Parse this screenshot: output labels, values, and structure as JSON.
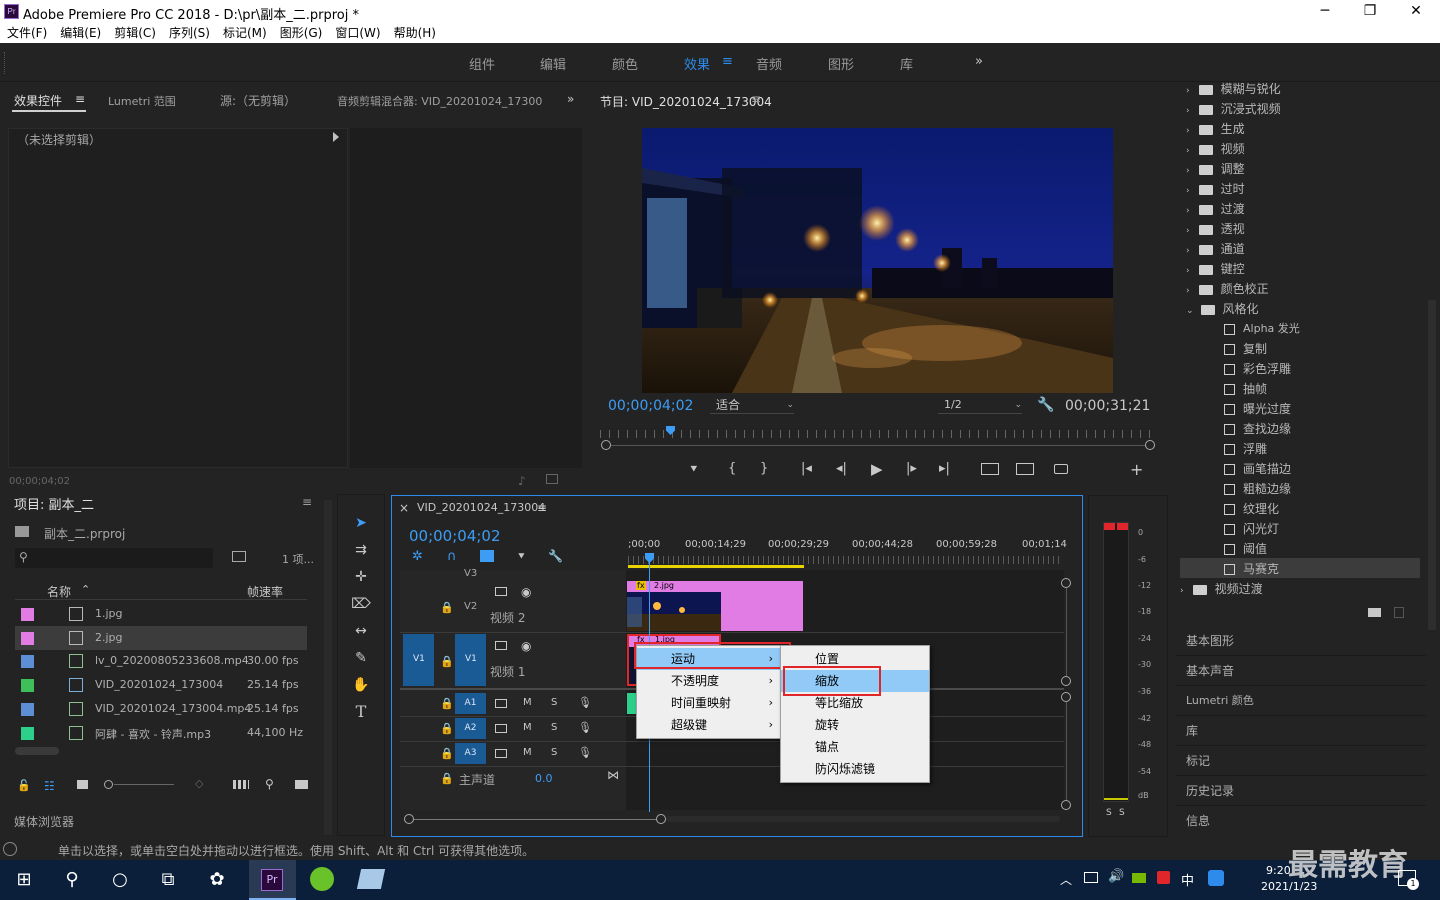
{
  "window": {
    "app_logo": "Pr",
    "title": "Adobe Premiere Pro CC 2018 - D:\\pr\\副本_二.prproj *",
    "minimize": "─",
    "maximize": "❐",
    "close": "✕"
  },
  "menu": [
    "文件(F)",
    "编辑(E)",
    "剪辑(C)",
    "序列(S)",
    "标记(M)",
    "图形(G)",
    "窗口(W)",
    "帮助(H)"
  ],
  "workspaces": {
    "items": [
      "组件",
      "编辑",
      "颜色",
      "效果",
      "音频",
      "图形",
      "库"
    ],
    "active": "效果",
    "more": "»",
    "menu_icon": "≡"
  },
  "effect_controls": {
    "tabs": [
      "效果控件",
      "Lumetri 范围",
      "源:（无剪辑）",
      "音频剪辑混合器: VID_20201024_17300"
    ],
    "active_tab": "效果控件",
    "tab_menu": "≡",
    "more": "»",
    "no_clip": "（未选择剪辑）",
    "timecode": "00;00;04;02"
  },
  "program": {
    "title": "节目: VID_20201024_173004",
    "menu": "≡",
    "timecode_current": "00;00;04;02",
    "zoom": "适合",
    "resolution": "1/2",
    "timecode_duration": "00;00;31;21",
    "add": "+"
  },
  "project": {
    "title": "项目: 副本_二",
    "menu": "≡",
    "file": "副本_二.prproj",
    "count": "1 项...",
    "columns": [
      "名称",
      "帧速率"
    ],
    "rows": [
      {
        "name": "1.jpg",
        "fps": "",
        "color": "#e27ce5"
      },
      {
        "name": "2.jpg",
        "fps": "",
        "color": "#e27ce5"
      },
      {
        "name": "lv_0_20200805233608.mp4",
        "fps": "30.00 fps",
        "color": "#5d8fd4"
      },
      {
        "name": "VID_20201024_173004",
        "fps": "25.14 fps",
        "color": "#3fbf5a"
      },
      {
        "name": "VID_20201024_173004.mp4",
        "fps": "25.14 fps",
        "color": "#5d8fd4"
      },
      {
        "name": "阿肆 - 喜欢 - 铃声.mp3",
        "fps": "44,100 Hz",
        "color": "#2ecf8a"
      }
    ],
    "media_browser": "媒体浏览器"
  },
  "timeline": {
    "tab": "VID_20201024_173004",
    "close": "×",
    "menu": "≡",
    "timecode": "00;00;04;02",
    "ruler": [
      ";00;00",
      "00;00;14;29",
      "00;00;29;29",
      "00;00;44;28",
      "00;00;59;28",
      "00;01;14"
    ],
    "tracks": {
      "v3": "V3",
      "v2": "V2",
      "v2_name": "视频 2",
      "v1": "V1",
      "v1_name": "视频 1",
      "a1": "A1",
      "a2": "A2",
      "a3": "A3",
      "master": "主声道",
      "master_val": "0.0",
      "m": "M",
      "s": "S"
    },
    "clips": {
      "clip2": "2.jpg",
      "clip1": "1.jpg",
      "fx": "fx"
    }
  },
  "context_menu": {
    "items": [
      "运动",
      "不透明度",
      "时间重映射",
      "超级键"
    ],
    "highlighted": "运动",
    "submenu": [
      "位置",
      "缩放",
      "等比缩放",
      "旋转",
      "锚点",
      "防闪烁滤镜"
    ],
    "sub_highlighted": "缩放",
    "arrow": "›"
  },
  "meter": {
    "scale": [
      "0",
      "-6",
      "-12",
      "-18",
      "-24",
      "-30",
      "-36",
      "-42",
      "-48",
      "-54",
      "dB"
    ],
    "solo": [
      "S",
      "S"
    ]
  },
  "effects_list": {
    "folders": [
      "模糊与锐化",
      "沉浸式视频",
      "生成",
      "视频",
      "调整",
      "过时",
      "过渡",
      "透视",
      "通道",
      "键控",
      "颜色校正"
    ],
    "open_folder": "风格化",
    "children": [
      "Alpha 发光",
      "复制",
      "彩色浮雕",
      "抽帧",
      "曝光过度",
      "查找边缘",
      "浮雕",
      "画笔描边",
      "粗糙边缘",
      "纹理化",
      "闪光灯",
      "阈值",
      "马赛克"
    ],
    "selected": "马赛克",
    "after_folder": "视频过渡",
    "sections": [
      "基本图形",
      "基本声音",
      "Lumetri 颜色",
      "库",
      "标记",
      "历史记录",
      "信息"
    ]
  },
  "status": "单击以选择，或单击空白处并拖动以进行框选。使用 Shift、Alt 和 Ctrl 可获得其他选项。",
  "taskbar": {
    "time": "9:20",
    "date": "2021/1/23",
    "ime": "中",
    "watermark": "最需教育",
    "notification_count": "1"
  },
  "colors": {
    "accent": "#2d8ceb",
    "timecode": "#3d9df5",
    "highlight": "#91c9f7",
    "callout": "#e0262a",
    "clip_pink": "#e27ce5"
  }
}
